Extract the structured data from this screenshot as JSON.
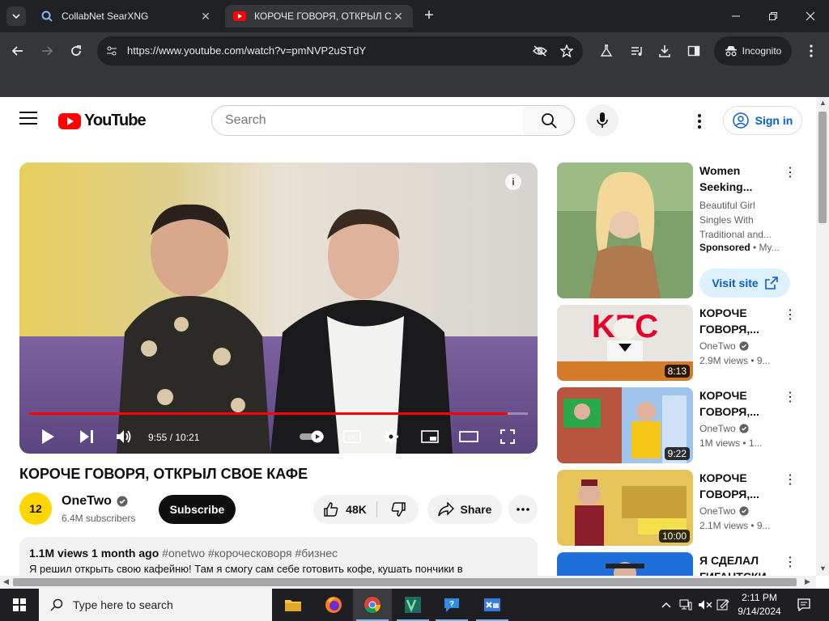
{
  "browser": {
    "tabs": [
      {
        "title": "CollabNet SearXNG"
      },
      {
        "title": "КОРОЧЕ ГОВОРЯ, ОТКРЫЛ СВ"
      }
    ],
    "url": "https://www.youtube.com/watch?v=pmNVP2uSTdY",
    "incognito_label": "Incognito"
  },
  "youtube": {
    "logo_text": "YouTube",
    "search_placeholder": "Search",
    "signin_label": "Sign in"
  },
  "player": {
    "time_display": "9:55 / 10:21",
    "progress_fraction": 0.96
  },
  "video": {
    "title": "КОРОЧЕ ГОВОРЯ, ОТКРЫЛ СВОЕ КАФЕ",
    "channel_name": "OneTwo",
    "channel_avatar_text": "12",
    "subscribers": "6.4M subscribers",
    "subscribe_label": "Subscribe",
    "likes": "48K",
    "share_label": "Share",
    "views": "1.1M views",
    "age": "1 month ago",
    "hashtags": "#onetwo #короческоворя #бизнес",
    "description": "Я решил открыть свою кафейню! Там я смогу сам себе готовить кофе, кушать пончики в"
  },
  "sidebar": {
    "ad": {
      "title": "Women Seeking...",
      "description": "Beautiful Girl Singles With Traditional and...",
      "sponsored": "Sponsored",
      "advertiser": "• My...",
      "cta": "Visit site"
    },
    "recommendations": [
      {
        "title": "КОРОЧЕ ГОВОРЯ,...",
        "channel": "OneTwo",
        "stats": "2.9M views • 9...",
        "duration": "8:13"
      },
      {
        "title": "КОРОЧЕ ГОВОРЯ,...",
        "channel": "OneTwo",
        "stats": "1M views • 1...",
        "duration": "9:22"
      },
      {
        "title": "КОРОЧЕ ГОВОРЯ,...",
        "channel": "OneTwo",
        "stats": "2.1M views • 9...",
        "duration": "10:00"
      },
      {
        "title": "Я СДЕЛАЛ ГИГАНТСКИ",
        "channel": "",
        "stats": "",
        "duration": ""
      }
    ]
  },
  "taskbar": {
    "search_placeholder": "Type here to search",
    "time": "2:11 PM",
    "date": "9/14/2024"
  }
}
